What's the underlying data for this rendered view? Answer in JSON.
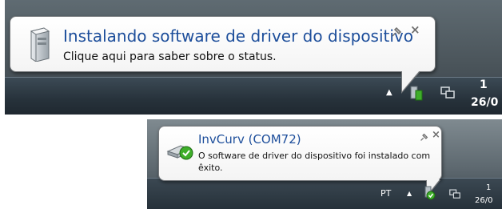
{
  "top_notification": {
    "title": "Instalando software de driver do dispositivo",
    "message": "Clique aqui para saber sobre o status.",
    "pin_icon": "pin-icon",
    "close_glyph": "×",
    "clock_time": "1",
    "clock_date": "26/0"
  },
  "bottom_notification": {
    "title": "InvCurv (COM72)",
    "message": "O software de driver do dispositivo foi instalado com êxito.",
    "pin_icon": "pin-icon",
    "close_glyph": "×",
    "language": "PT",
    "clock_time": "1",
    "clock_date": "26/0"
  },
  "colors": {
    "title_blue": "#1d4e9b",
    "taskbar_dark": "#27323b",
    "success_green": "#3fae2a"
  }
}
